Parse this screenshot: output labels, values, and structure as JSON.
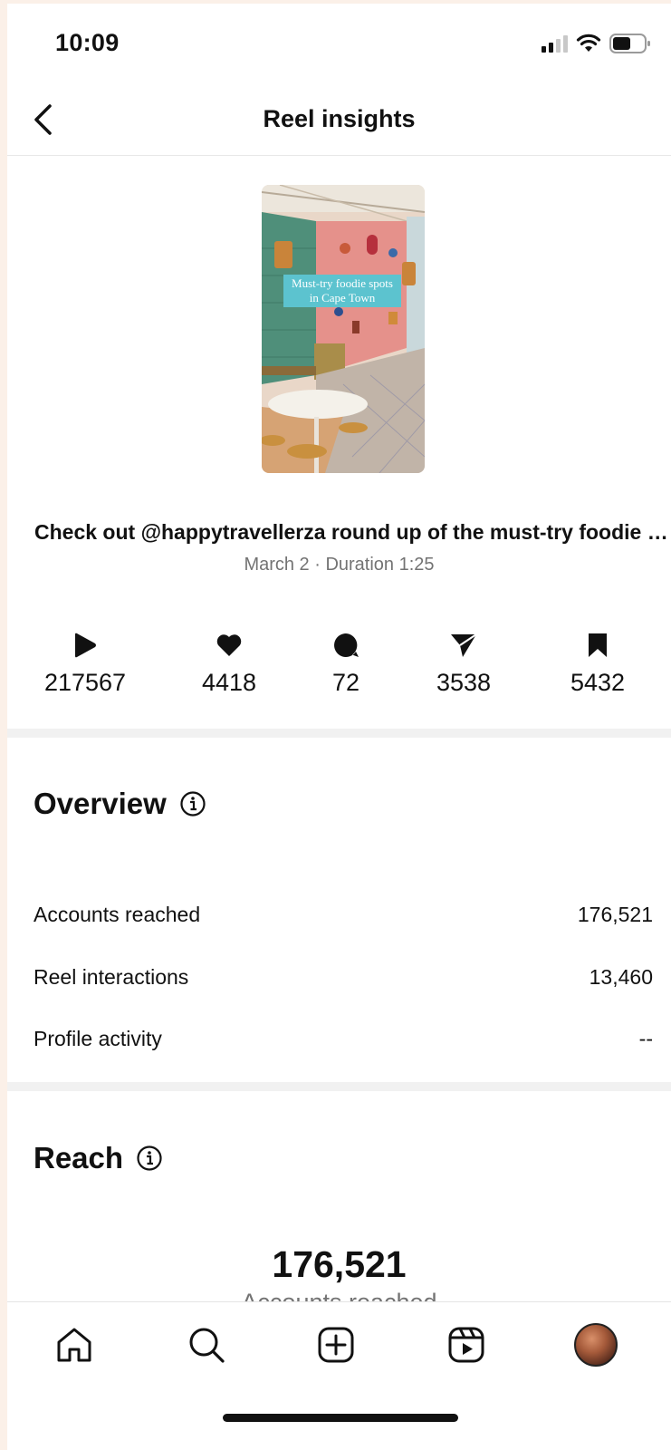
{
  "status_bar": {
    "time": "10:09"
  },
  "nav": {
    "title": "Reel insights"
  },
  "reel": {
    "thumbnail_text": "Must-try foodie spots in Cape Town",
    "caption": "Check out @happytravellerza round up of the must-try foodie spots in Cape Town",
    "meta": "March 2 · Duration 1:25"
  },
  "stats": {
    "plays": "217567",
    "likes": "4418",
    "comments": "72",
    "shares": "3538",
    "saves": "5432"
  },
  "overview": {
    "title": "Overview",
    "rows": [
      {
        "label": "Accounts reached",
        "value": "176,521"
      },
      {
        "label": "Reel interactions",
        "value": "13,460"
      },
      {
        "label": "Profile activity",
        "value": "--"
      }
    ]
  },
  "reach": {
    "title": "Reach",
    "value": "176,521",
    "label": "Accounts reached"
  },
  "tabbar": {
    "icons": [
      "home-icon",
      "search-icon",
      "create-icon",
      "reels-icon",
      "profile-avatar"
    ]
  }
}
